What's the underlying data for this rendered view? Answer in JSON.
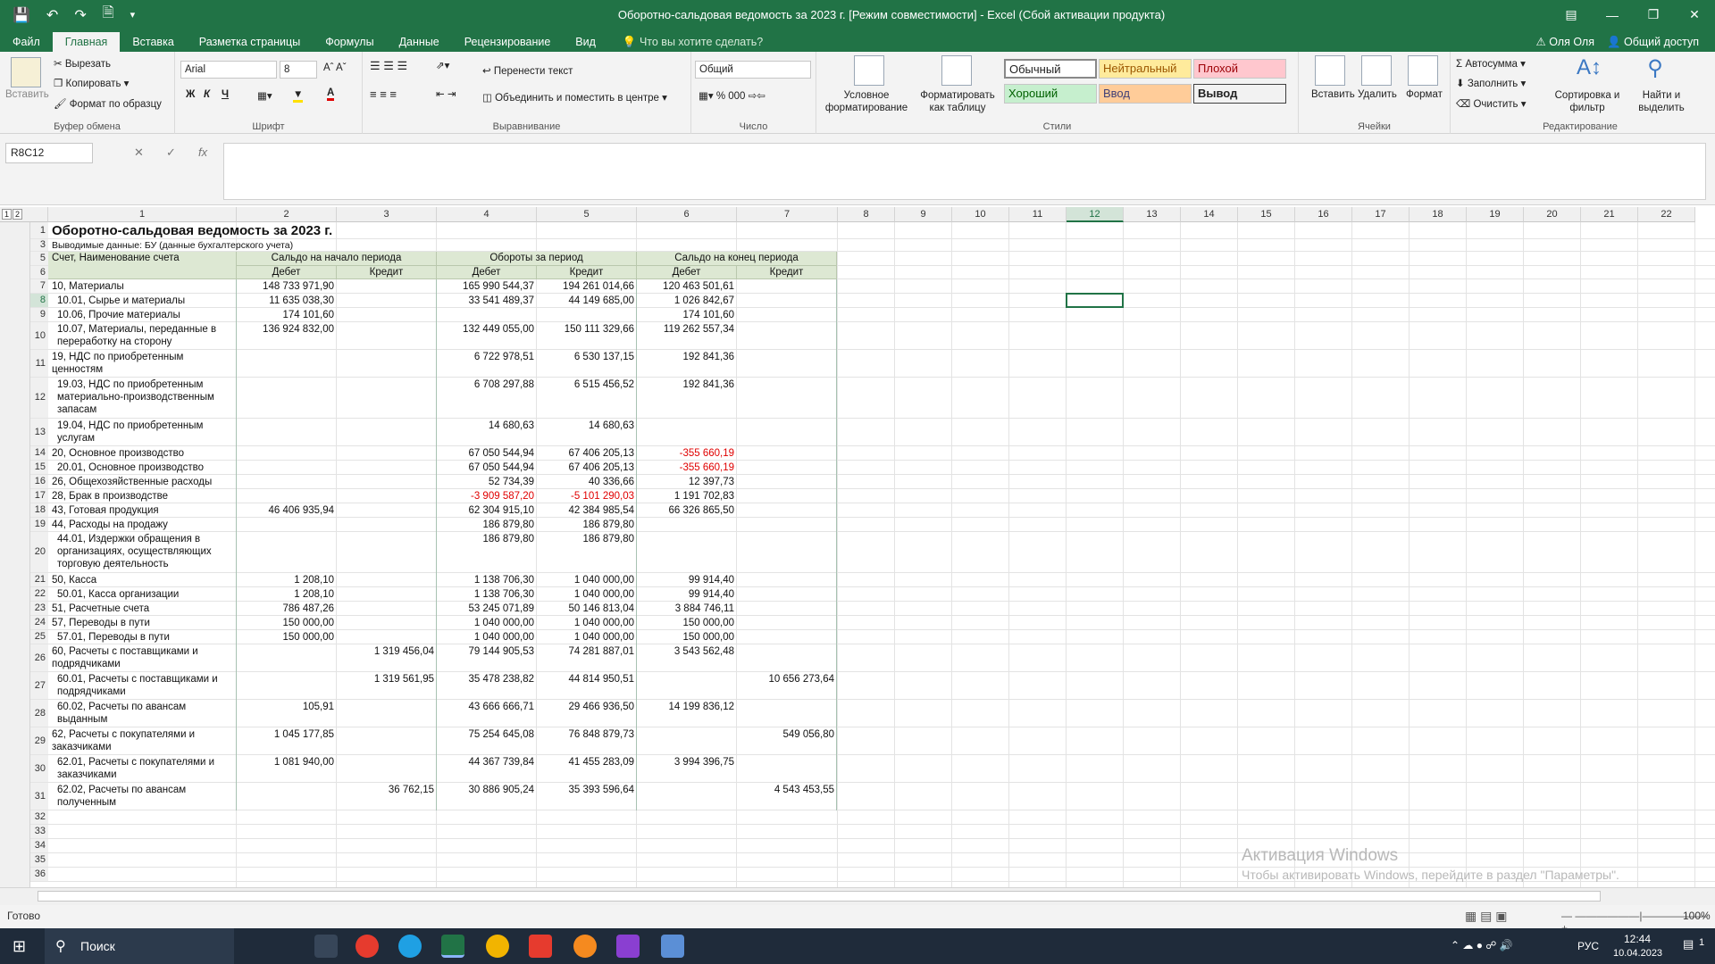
{
  "window": {
    "title": "Оборотно-сальдовая ведомость за 2023 г.  [Режим совместимости] - Excel (Сбой активации продукта)"
  },
  "menu": {
    "tabs": [
      "Файл",
      "Главная",
      "Вставка",
      "Разметка страницы",
      "Формулы",
      "Данные",
      "Рецензирование",
      "Вид"
    ],
    "tell_me": "Что вы хотите сделать?",
    "user": "Оля Оля",
    "share": "Общий доступ"
  },
  "ribbon": {
    "clipboard": {
      "paste": "Вставить",
      "cut": "Вырезать",
      "copy": "Копировать",
      "format_painter": "Формат по образцу",
      "label": "Буфер обмена"
    },
    "font": {
      "name": "Arial",
      "size": "8",
      "bold": "Ж",
      "italic": "К",
      "underline": "Ч",
      "label": "Шрифт"
    },
    "alignment": {
      "wrap": "Перенести текст",
      "merge": "Объединить и поместить в центре",
      "label": "Выравнивание"
    },
    "number": {
      "format": "Общий",
      "label": "Число"
    },
    "styles": {
      "conditional": "Условное форматирование",
      "as_table": "Форматировать как таблицу",
      "normal": "Обычный",
      "neutral": "Нейтральный",
      "bad": "Плохой",
      "good": "Хороший",
      "input": "Ввод",
      "output": "Вывод",
      "label": "Стили"
    },
    "cells": {
      "insert": "Вставить",
      "delete": "Удалить",
      "format": "Формат",
      "label": "Ячейки"
    },
    "editing": {
      "autosum": "Автосумма",
      "fill": "Заполнить",
      "clear": "Очистить",
      "sort": "Сортировка и фильтр",
      "find": "Найти и выделить",
      "label": "Редактирование"
    }
  },
  "formula_bar": {
    "name_box": "R8C12",
    "formula": ""
  },
  "sheet": {
    "columns": [
      "1",
      "2",
      "3",
      "4",
      "5",
      "6",
      "7",
      "8",
      "9",
      "10",
      "11",
      "12",
      "13",
      "14",
      "15",
      "16",
      "17",
      "18",
      "19",
      "20",
      "21",
      "22"
    ],
    "title": "Оборотно-сальдовая ведомость за 2023 г.",
    "subtitle": "Выводимые данные: БУ (данные бухгалтерского учета)",
    "header": {
      "account": "Счет, Наименование счета",
      "opening": "Сальдо на начало периода",
      "turnover": "Обороты за период",
      "closing": "Сальдо на конец периода",
      "debit": "Дебет",
      "credit": "Кредит"
    },
    "rows": [
      {
        "n": "7",
        "name": "10, Материалы",
        "v": [
          "148 733 971,90",
          "",
          "165 990 544,37",
          "194 261 014,66",
          "120 463 501,61",
          ""
        ]
      },
      {
        "n": "8",
        "name": "  10.01, Сырье и материалы",
        "v": [
          "11 635 038,30",
          "",
          "33 541 489,37",
          "44 149 685,00",
          "1 026 842,67",
          ""
        ]
      },
      {
        "n": "9",
        "name": "  10.06, Прочие материалы",
        "v": [
          "174 101,60",
          "",
          "",
          "",
          "174 101,60",
          ""
        ]
      },
      {
        "n": "10",
        "name": "  10.07, Материалы, переданные в переработку на сторону",
        "v": [
          "136 924 832,00",
          "",
          "132 449 055,00",
          "150 111 329,66",
          "119 262 557,34",
          ""
        ]
      },
      {
        "n": "11",
        "name": "19, НДС по приобретенным ценностям",
        "v": [
          "",
          "",
          "6 722 978,51",
          "6 530 137,15",
          "192 841,36",
          ""
        ]
      },
      {
        "n": "12",
        "name": "  19.03, НДС по приобретенным материально-производственным запасам",
        "v": [
          "",
          "",
          "6 708 297,88",
          "6 515 456,52",
          "192 841,36",
          ""
        ]
      },
      {
        "n": "13",
        "name": "  19.04, НДС по приобретенным услугам",
        "v": [
          "",
          "",
          "14 680,63",
          "14 680,63",
          "",
          ""
        ]
      },
      {
        "n": "14",
        "name": "20, Основное производство",
        "v": [
          "",
          "",
          "67 050 544,94",
          "67 406 205,13",
          "-355 660,19",
          ""
        ]
      },
      {
        "n": "15",
        "name": "  20.01, Основное производство",
        "v": [
          "",
          "",
          "67 050 544,94",
          "67 406 205,13",
          "-355 660,19",
          ""
        ]
      },
      {
        "n": "16",
        "name": "26, Общехозяйственные расходы",
        "v": [
          "",
          "",
          "52 734,39",
          "40 336,66",
          "12 397,73",
          ""
        ]
      },
      {
        "n": "17",
        "name": "28, Брак в производстве",
        "v": [
          "",
          "",
          "-3 909 587,20",
          "-5 101 290,03",
          "1 191 702,83",
          ""
        ]
      },
      {
        "n": "18",
        "name": "43, Готовая продукция",
        "v": [
          "46 406 935,94",
          "",
          "62 304 915,10",
          "42 384 985,54",
          "66 326 865,50",
          ""
        ]
      },
      {
        "n": "19",
        "name": "44, Расходы на продажу",
        "v": [
          "",
          "",
          "186 879,80",
          "186 879,80",
          "",
          ""
        ]
      },
      {
        "n": "20",
        "name": "  44.01, Издержки обращения в организациях, осуществляющих торговую деятельность",
        "v": [
          "",
          "",
          "186 879,80",
          "186 879,80",
          "",
          ""
        ]
      },
      {
        "n": "21",
        "name": "50, Касса",
        "v": [
          "1 208,10",
          "",
          "1 138 706,30",
          "1 040 000,00",
          "99 914,40",
          ""
        ]
      },
      {
        "n": "22",
        "name": "  50.01, Касса организации",
        "v": [
          "1 208,10",
          "",
          "1 138 706,30",
          "1 040 000,00",
          "99 914,40",
          ""
        ]
      },
      {
        "n": "23",
        "name": "51, Расчетные счета",
        "v": [
          "786 487,26",
          "",
          "53 245 071,89",
          "50 146 813,04",
          "3 884 746,11",
          ""
        ]
      },
      {
        "n": "24",
        "name": "57, Переводы в пути",
        "v": [
          "150 000,00",
          "",
          "1 040 000,00",
          "1 040 000,00",
          "150 000,00",
          ""
        ]
      },
      {
        "n": "25",
        "name": "  57.01, Переводы в пути",
        "v": [
          "150 000,00",
          "",
          "1 040 000,00",
          "1 040 000,00",
          "150 000,00",
          ""
        ]
      },
      {
        "n": "26",
        "name": "60, Расчеты с поставщиками и подрядчиками",
        "v": [
          "",
          "1 319 456,04",
          "79 144 905,53",
          "74 281 887,01",
          "3 543 562,48",
          ""
        ]
      },
      {
        "n": "27",
        "name": "  60.01, Расчеты с поставщиками и подрядчиками",
        "v": [
          "",
          "1 319 561,95",
          "35 478 238,82",
          "44 814 950,51",
          "",
          "10 656 273,64"
        ]
      },
      {
        "n": "28",
        "name": "  60.02, Расчеты по авансам выданным",
        "v": [
          "105,91",
          "",
          "43 666 666,71",
          "29 466 936,50",
          "14 199 836,12",
          ""
        ]
      },
      {
        "n": "29",
        "name": "62, Расчеты с покупателями и заказчиками",
        "v": [
          "1 045 177,85",
          "",
          "75 254 645,08",
          "76 848 879,73",
          "",
          "549 056,80"
        ]
      },
      {
        "n": "30",
        "name": "  62.01, Расчеты с покупателями и заказчиками",
        "v": [
          "1 081 940,00",
          "",
          "44 367 739,84",
          "41 455 283,09",
          "3 994 396,75",
          ""
        ]
      },
      {
        "n": "31",
        "name": "  62.02, Расчеты по авансам полученным",
        "v": [
          "",
          "36 762,15",
          "30 886 905,24",
          "35 393 596,64",
          "",
          "4 543 453,55"
        ]
      },
      {
        "n": "32",
        "name": "",
        "v": [
          "",
          "",
          "",
          "",
          "",
          ""
        ]
      },
      {
        "n": "33",
        "name": "",
        "v": [
          "",
          "",
          "",
          "",
          "",
          ""
        ]
      },
      {
        "n": "34",
        "name": "",
        "v": [
          "",
          "",
          "",
          "",
          "",
          ""
        ]
      },
      {
        "n": "35",
        "name": "",
        "v": [
          "",
          "",
          "",
          "",
          "",
          ""
        ]
      },
      {
        "n": "36",
        "name": "",
        "v": [
          "",
          "",
          "",
          "",
          "",
          ""
        ]
      }
    ]
  },
  "watermark": {
    "line1": "Активация Windows",
    "line2": "Чтобы активировать Windows, перейдите в раздел \"Параметры\"."
  },
  "status": {
    "ready": "Готово",
    "zoom": "100%"
  },
  "taskbar": {
    "search": "Поиск",
    "lang": "РУС",
    "time": "12:44",
    "date": "10.04.2023",
    "notif": "1"
  }
}
